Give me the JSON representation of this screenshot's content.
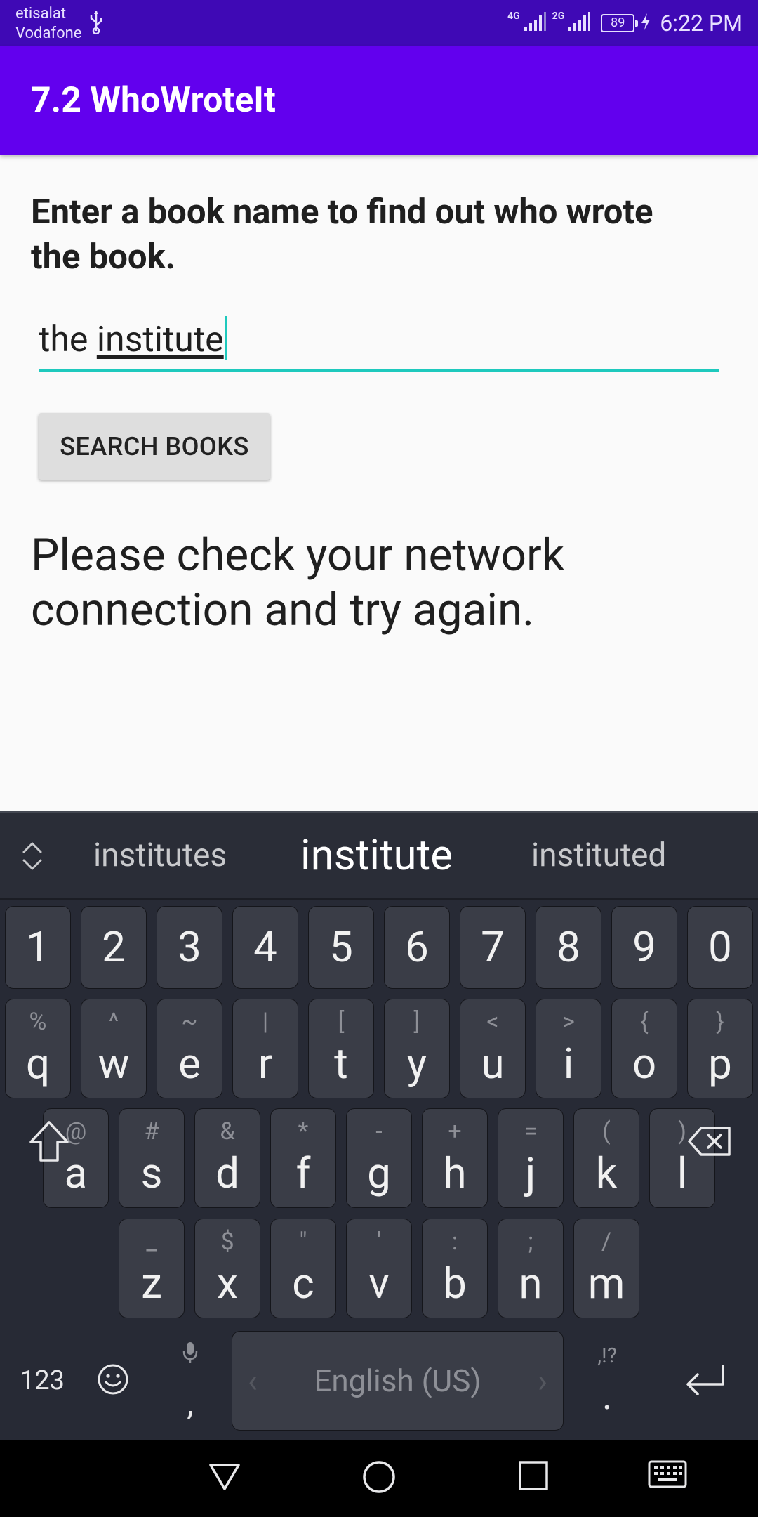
{
  "status_bar": {
    "carrier_1": "etisalat",
    "carrier_2": "Vodafone",
    "net_1": "4G",
    "net_2": "2G",
    "battery": "89",
    "time": "6:22 PM"
  },
  "app_bar": {
    "title": "7.2 WhoWroteIt"
  },
  "main": {
    "instructions": "Enter a book name to find out who wrote the book.",
    "book_input_prefix": "the ",
    "book_input_composing": "institute",
    "search_button": "SEARCH BOOKS",
    "result": "Please check your network connection and try again."
  },
  "keyboard": {
    "suggestions": [
      "institutes",
      "institute",
      "instituted"
    ],
    "number_row": [
      "1",
      "2",
      "3",
      "4",
      "5",
      "6",
      "7",
      "8",
      "9",
      "0"
    ],
    "row1": [
      {
        "main": "q",
        "sub": "%"
      },
      {
        "main": "w",
        "sub": "^"
      },
      {
        "main": "e",
        "sub": "~"
      },
      {
        "main": "r",
        "sub": "|"
      },
      {
        "main": "t",
        "sub": "["
      },
      {
        "main": "y",
        "sub": "]"
      },
      {
        "main": "u",
        "sub": "<"
      },
      {
        "main": "i",
        "sub": ">"
      },
      {
        "main": "o",
        "sub": "{"
      },
      {
        "main": "p",
        "sub": "}"
      }
    ],
    "row2": [
      {
        "main": "a",
        "sub": "@"
      },
      {
        "main": "s",
        "sub": "#"
      },
      {
        "main": "d",
        "sub": "&"
      },
      {
        "main": "f",
        "sub": "*"
      },
      {
        "main": "g",
        "sub": "-"
      },
      {
        "main": "h",
        "sub": "+"
      },
      {
        "main": "j",
        "sub": "="
      },
      {
        "main": "k",
        "sub": "("
      },
      {
        "main": "l",
        "sub": ")"
      }
    ],
    "row3": [
      {
        "main": "z",
        "sub": "_"
      },
      {
        "main": "x",
        "sub": "$"
      },
      {
        "main": "c",
        "sub": "\""
      },
      {
        "main": "v",
        "sub": "'"
      },
      {
        "main": "b",
        "sub": ":"
      },
      {
        "main": "n",
        "sub": ";"
      },
      {
        "main": "m",
        "sub": "/"
      }
    ],
    "symbols_label": "123",
    "comma": ",",
    "space_label": "English (US)",
    "punct_hint": ",!?",
    "period": "."
  },
  "icons": {
    "usb": "usb-icon",
    "signal": "signal-icon",
    "charging": "charging-bolt-icon",
    "expand": "expand-suggestions-icon",
    "shift": "shift-icon",
    "backspace": "backspace-icon",
    "emoji": "emoji-icon",
    "mic": "mic-icon",
    "enter": "enter-icon",
    "back": "nav-back-icon",
    "home": "nav-home-icon",
    "recents": "nav-recents-icon",
    "keyboard": "nav-keyboard-icon"
  }
}
